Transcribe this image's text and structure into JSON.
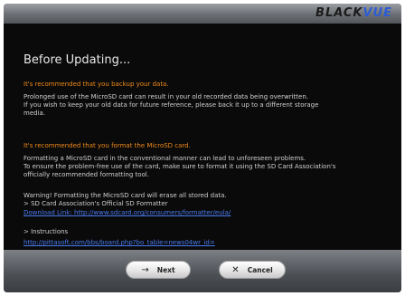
{
  "window": {
    "logo_part1": "BLACK",
    "logo_part2": "VUE"
  },
  "content": {
    "heading": "Before Updating...",
    "backup_title": "It's recommended that you backup your data.",
    "backup_line1": "Prolonged use of the MicroSD card can result in your old recorded data being overwritten.",
    "backup_line2": "If you wish to keep your old data for future reference, please back it up to a different storage",
    "backup_line3": "media.",
    "format_title": "It's recommended that you format the MicroSD card.",
    "format_line1": "Formatting a MicroSD card in the conventional manner can lead to unforeseen problems.",
    "format_line2": "To ensure the problem-free use of the card, make sure to format it using the SD Card Association's",
    "format_line3": "officially recommended formatting tool.",
    "warning_line": "Warning! Formatting the MicroSD card will erase all stored data.",
    "formatter_label": "> SD Card Association's Official SD Formatter",
    "download_link": "Download Link: http://www.sdcard.org/consumers/formatter/eula/",
    "instructions_label": "> Instructions",
    "instructions_link": "http://pittasoft.com/bbs/board.php?bo_table=news04wr_id="
  },
  "footer": {
    "next_label": "Next",
    "cancel_label": "Cancel",
    "next_icon": "arrow-right-icon",
    "cancel_icon": "x-icon"
  }
}
